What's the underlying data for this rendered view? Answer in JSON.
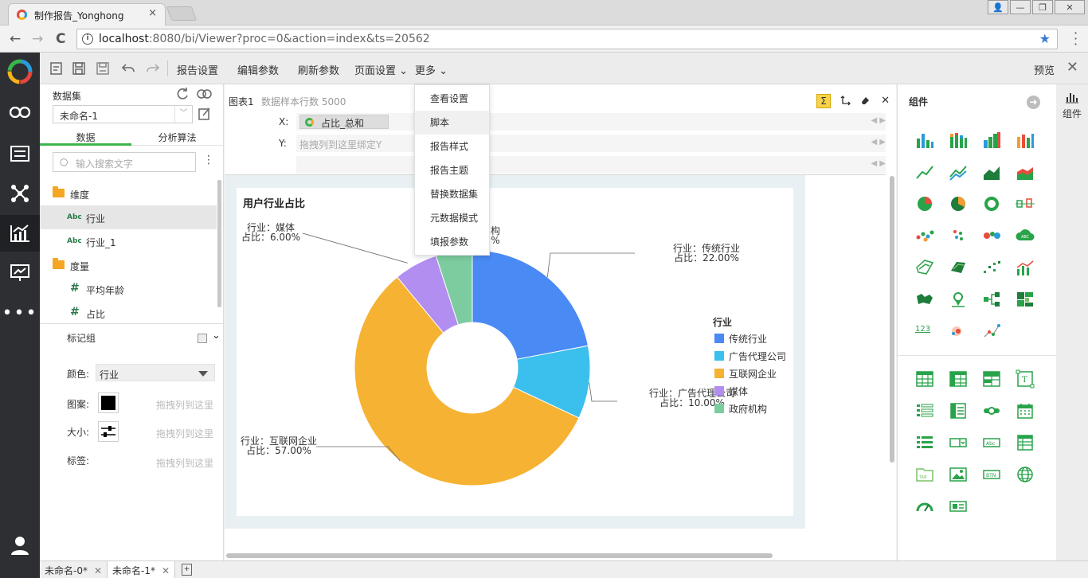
{
  "browser": {
    "tab_title": "制作报告_Yonghong",
    "tab_close": "×",
    "url_host": "localhost",
    "url_rest": ":8080/bi/Viewer?proc=0&action=index&ts=20562",
    "nav_back": "←",
    "nav_forward": "→",
    "nav_reload": "C",
    "info_glyph": "i",
    "star_glyph": "★",
    "win_user": "👤",
    "win_min": "—",
    "win_max": "❐",
    "win_close": "✕"
  },
  "toolbar": {
    "report_settings": "报告设置",
    "edit_params": "编辑参数",
    "refresh_params": "刷新参数",
    "page_settings": "页面设置 ⌄",
    "more": "更多 ⌄",
    "preview": "预览",
    "close_glyph": "✕"
  },
  "more_menu": {
    "items": [
      "查看设置",
      "脚本",
      "报告样式",
      "报告主题",
      "替换数据集",
      "元数据模式",
      "填报参数"
    ]
  },
  "data_panel": {
    "title": "数据集",
    "dataset_value": "未命名-1",
    "dataset_arrow": "﹀",
    "tabs": [
      "数据",
      "分析算法"
    ],
    "search_placeholder": "输入搜索文字",
    "search_glyph": "○",
    "menu_glyph": "⋮",
    "dimension_label": "维度",
    "dimension_items": [
      "行业",
      "行业_1"
    ],
    "measure_label": "度量",
    "measure_items": [
      "平均年龄",
      "占比"
    ],
    "abc_badge": "Abc",
    "hash_badge": "#"
  },
  "marks": {
    "title": "标记组",
    "color_label": "颜色:",
    "color_value": "行业",
    "shape_label": "图案:",
    "size_label": "大小:",
    "label_label": "标签:",
    "drop_hint": "拖拽列到这里",
    "chevron": "⌄"
  },
  "editor": {
    "chart_name": "图表1",
    "sample_rows": "数据样本行数 5000",
    "sigma_glyph": "Σ",
    "x_label": "X:",
    "y_label": "Y:",
    "x_field": "占比_总和",
    "y_placeholder": "拖拽列到这里绑定Y",
    "arrow_glyph": "◀ ▶",
    "close_glyph": "✕"
  },
  "chart_data": {
    "type": "pie",
    "donut": true,
    "title": "用户行业占比",
    "legend_title": "行业",
    "legend_position": "right",
    "label_prefix_category": "行业：",
    "label_prefix_value": "占比：",
    "slices": [
      {
        "name": "传统行业",
        "value": 22.0,
        "color": "#4a8af4"
      },
      {
        "name": "广告代理公司",
        "value": 10.0,
        "color": "#3bbfec"
      },
      {
        "name": "互联网企业",
        "value": 57.0,
        "color": "#f6b232"
      },
      {
        "name": "媒体",
        "value": 6.0,
        "color": "#b28ef0"
      },
      {
        "name": "政府机构",
        "value": 5.0,
        "color": "#7ccca0"
      }
    ],
    "slice_labels": {
      "传统行业": {
        "cat": "行业：传统行业",
        "val": "占比：22.00%"
      },
      "广告代理公司": {
        "cat": "行业：广告代理公司",
        "val": "占比：10.00%"
      },
      "互联网企业": {
        "cat": "行业：互联网企业",
        "val": "占比：57.00%"
      },
      "媒体": {
        "cat": "行业：媒体",
        "val": "占比：6.00%"
      },
      "政府机构": {
        "cat": "构",
        "val": "%"
      }
    }
  },
  "components": {
    "title": "组件",
    "rail_label": "组件",
    "next_glyph": "➜",
    "num_icon": "123"
  },
  "bottom_tabs": {
    "tabs": [
      "未命名-0*",
      "未命名-1*"
    ],
    "close_glyph": "✕"
  },
  "colors": {
    "accent_green": "#3bb54a",
    "nav_dark": "#2d2f33"
  }
}
